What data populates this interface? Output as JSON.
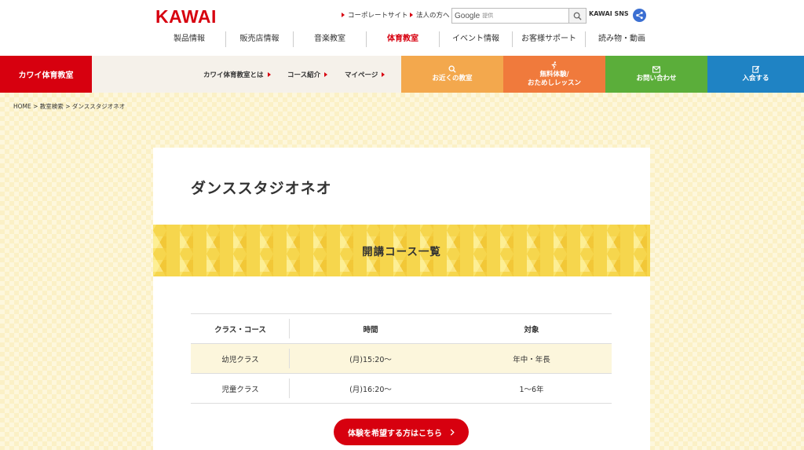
{
  "header": {
    "logo": "KAWAI",
    "links": [
      "コーポレートサイト",
      "法人の方へ"
    ],
    "search": {
      "brand": "Google",
      "provided": "提供",
      "value": ""
    },
    "sns_label": "KAWAI SNS",
    "nav": [
      {
        "label": "製品情報",
        "width": 92
      },
      {
        "label": "販売店情報",
        "width": 86
      },
      {
        "label": "音楽教室",
        "width": 93
      },
      {
        "label": "体育教室",
        "width": 93,
        "active": true
      },
      {
        "label": "イベント情報",
        "width": 93
      },
      {
        "label": "お客様サポート",
        "width": 93
      },
      {
        "label": "読み物・動画",
        "width": 93
      }
    ]
  },
  "subnav": {
    "brand": "カワイ体育教室",
    "links": [
      "カワイ体育教室とは",
      "コース紹介",
      "マイページ"
    ],
    "buttons": [
      {
        "icon": "search-icon",
        "label": "お近くの教室"
      },
      {
        "icon": "runner-icon",
        "label": "無料体験/\nおためしレッスン"
      },
      {
        "icon": "mail-icon",
        "label": "お問い合わせ"
      },
      {
        "icon": "edit-icon",
        "label": "入会する"
      }
    ]
  },
  "breadcrumb": "HOME > 教室検索 > ダンススタジオネオ",
  "page": {
    "title": "ダンススタジオネオ",
    "section_title": "開講コース一覧",
    "table": {
      "headers": [
        "クラス・コース",
        "時間",
        "対象"
      ],
      "rows": [
        [
          "幼児クラス",
          "(月)15:20〜",
          "年中・年長"
        ],
        [
          "児童クラス",
          "(月)16:20〜",
          "1〜6年"
        ]
      ]
    },
    "cta_label": "体験を希望する方はこちら"
  },
  "colors": {
    "accent_red": "#d7000f",
    "btn_orange": "#f3a84d",
    "btn_deep_orange": "#f07a3c",
    "btn_green": "#5bae3a",
    "btn_blue": "#1f83c4"
  }
}
